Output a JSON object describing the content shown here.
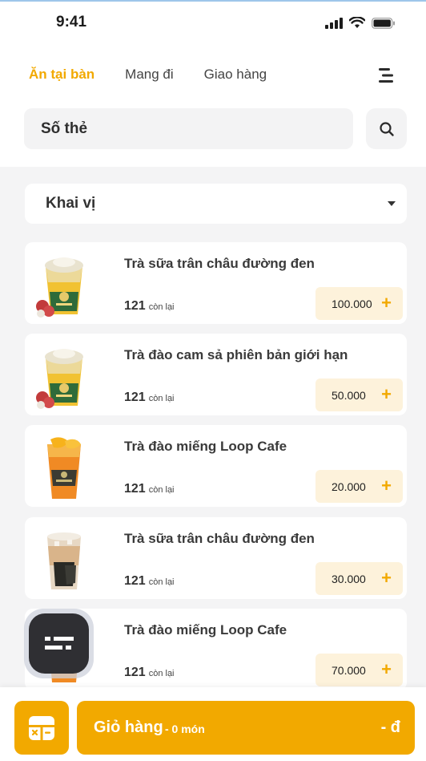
{
  "status_bar": {
    "time": "9:41"
  },
  "tabs": [
    {
      "label": "Ăn tại bàn",
      "active": true
    },
    {
      "label": "Mang đi",
      "active": false
    },
    {
      "label": "Giao hàng",
      "active": false
    }
  ],
  "search": {
    "placeholder": "Số thẻ"
  },
  "category": {
    "label": "Khai vị"
  },
  "products": [
    {
      "name": "Trà sữa trân châu đường đen",
      "stock": "121",
      "stock_suffix": "còn lại",
      "price": "100.000",
      "image": "lychee-tea-cup"
    },
    {
      "name": "Trà đào cam sả phiên bản giới hạn",
      "stock": "121",
      "stock_suffix": "còn lại",
      "price": "50.000",
      "image": "lychee-tea-cup"
    },
    {
      "name": "Trà đào miếng Loop Cafe",
      "stock": "121",
      "stock_suffix": "còn lại",
      "price": "20.000",
      "image": "peach-tea-cup"
    },
    {
      "name": "Trà sữa trân châu đường đen",
      "stock": "121",
      "stock_suffix": "còn lại",
      "price": "30.000",
      "image": "jelly-tea-cup"
    },
    {
      "name": "Trà đào miếng Loop Cafe",
      "stock": "121",
      "stock_suffix": "còn lại",
      "price": "70.000",
      "image": "peach-tea-cup"
    }
  ],
  "cart": {
    "label": "Giỏ hàng",
    "count": "- 0 món",
    "total": "- đ"
  },
  "colors": {
    "accent": "#f2a900",
    "price_bg": "#fdf2db",
    "background": "#f4f4f5"
  }
}
